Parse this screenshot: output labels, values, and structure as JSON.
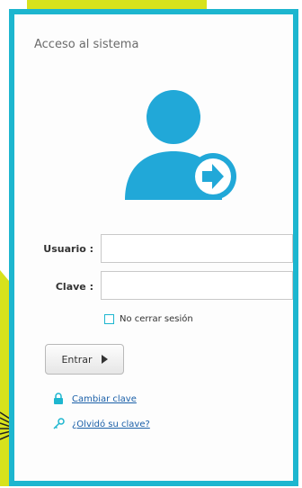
{
  "panel": {
    "title": "Acceso al sistema"
  },
  "avatar": {
    "icon": "user-login-icon",
    "colors": {
      "body": "#21a8d8",
      "badge": "#ffffff",
      "arrow": "#21a8d8"
    }
  },
  "form": {
    "user_label": "Usuario :",
    "user_value": "",
    "password_label": "Clave :",
    "password_value": "",
    "remember_label": "No cerrar sesión",
    "remember_checked": false
  },
  "buttons": {
    "enter_label": "Entrar"
  },
  "links": {
    "change_password": "Cambiar clave",
    "forgot_password": "¿Olvidó su clave?",
    "change_icon": "lock-icon",
    "forgot_icon": "key-icon"
  },
  "colors": {
    "accent": "#1db6cf",
    "background_decoration": "#d8e21c",
    "link": "#1a5fa8"
  }
}
